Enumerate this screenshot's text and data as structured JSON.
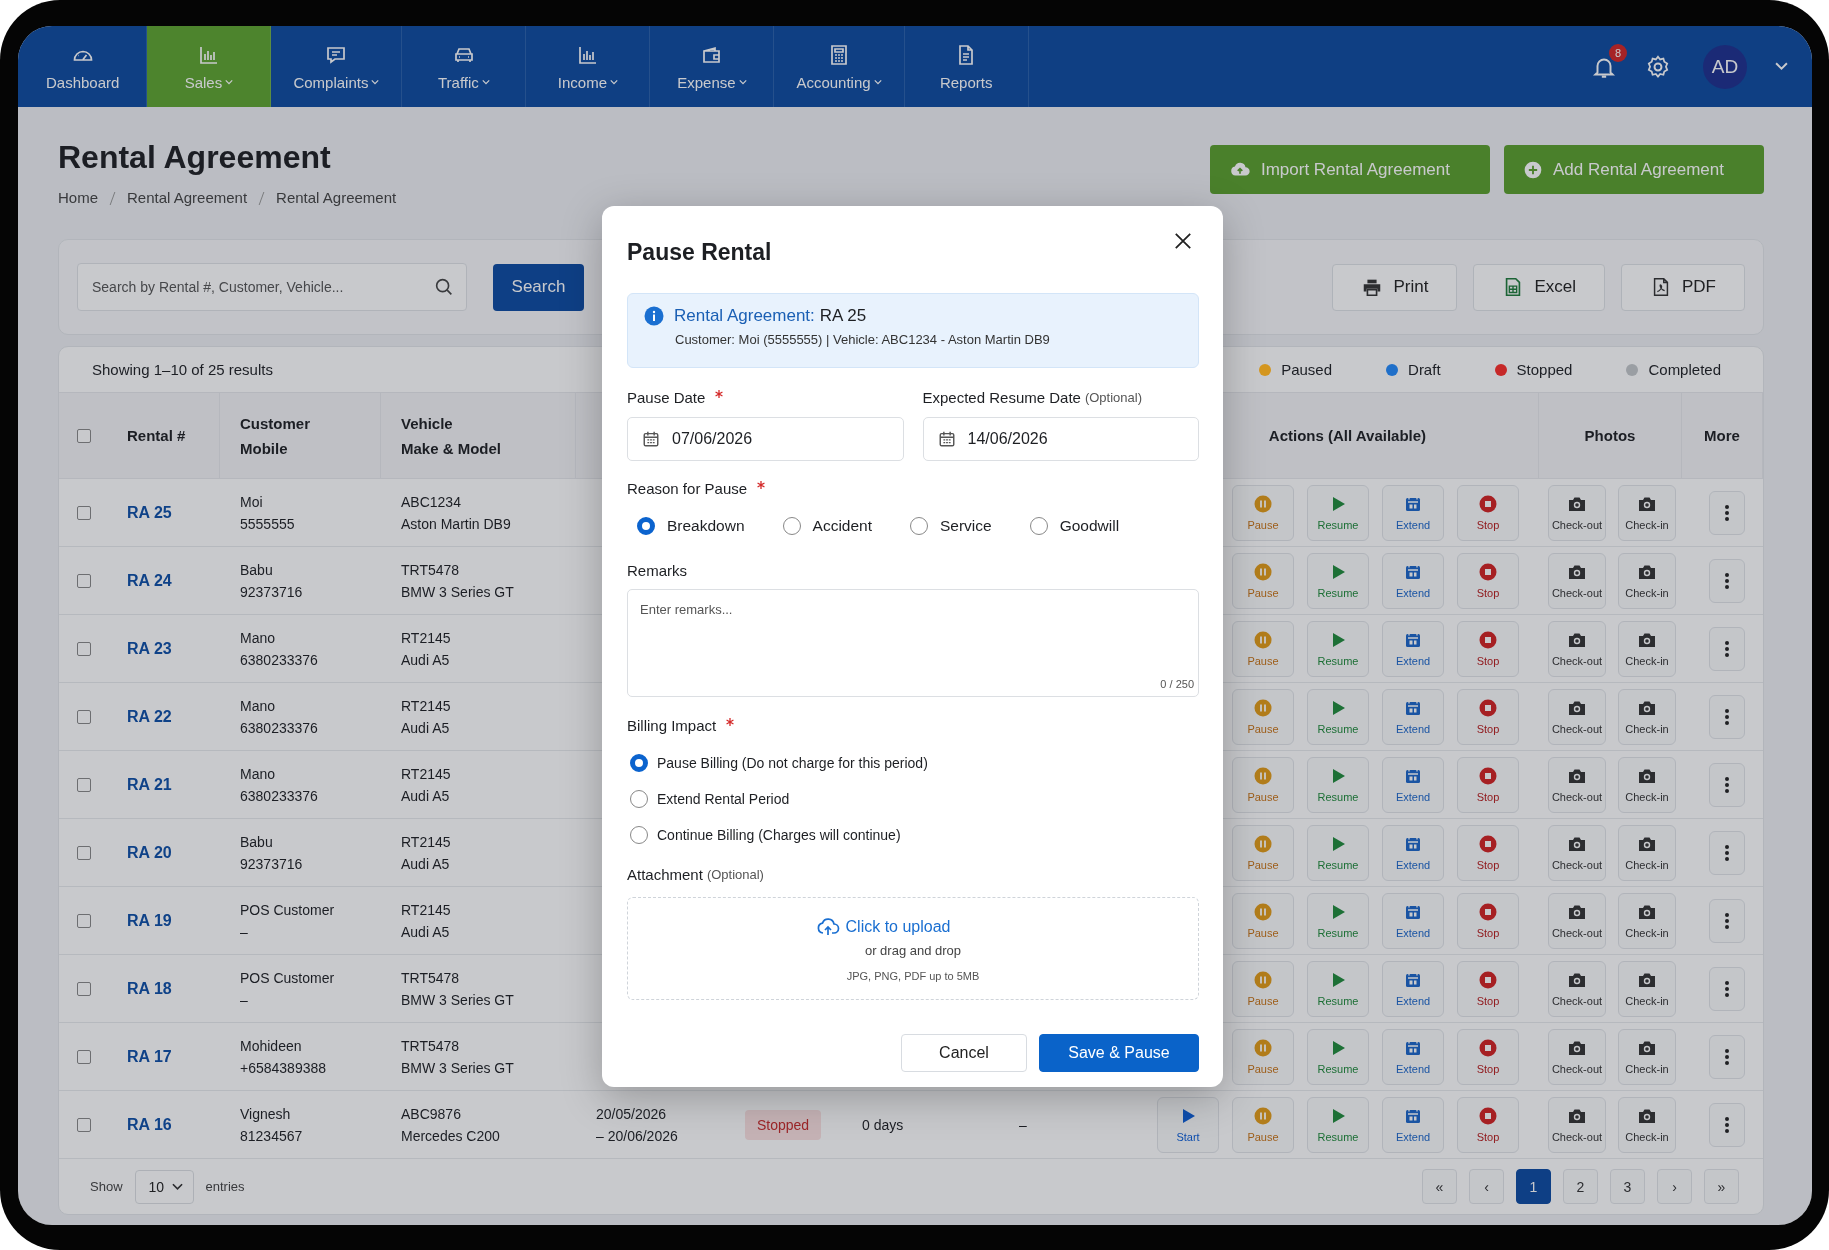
{
  "nav": {
    "items": [
      {
        "label": "Dashboard",
        "selected": false,
        "dropdown": false
      },
      {
        "label": "Sales",
        "selected": true,
        "dropdown": true
      },
      {
        "label": "Complaints",
        "selected": false,
        "dropdown": true
      },
      {
        "label": "Traffic",
        "selected": false,
        "dropdown": true
      },
      {
        "label": "Income",
        "selected": false,
        "dropdown": true
      },
      {
        "label": "Expense",
        "selected": false,
        "dropdown": true
      },
      {
        "label": "Accounting",
        "selected": false,
        "dropdown": true
      },
      {
        "label": "Reports",
        "selected": false,
        "dropdown": false
      }
    ],
    "notifications": "8",
    "user": "AD"
  },
  "page": {
    "title": "Rental Agreement",
    "breadcrumb": [
      "Home",
      "Rental Agreement",
      "Rental Agreement"
    ],
    "actions": [
      "Import Rental Agreement",
      "Add Rental Agreement"
    ]
  },
  "search": {
    "placeholder": "Search by Rental #, Customer, Vehicle...",
    "button": "Search"
  },
  "exports": [
    "Print",
    "Excel",
    "PDF"
  ],
  "summary": "Showing 1–10 of 25 results",
  "legend": [
    {
      "label": "Paused",
      "color": "#d4961f"
    },
    {
      "label": "Draft",
      "color": "#1f6fc9"
    },
    {
      "label": "Stopped",
      "color": "#c62828"
    },
    {
      "label": "Completed",
      "color": "#9a9ea3"
    }
  ],
  "table": {
    "checked": false,
    "columns": [
      [
        "Rental #"
      ],
      [
        "Customer",
        "Mobile"
      ],
      [
        "Vehicle",
        "Make & Model"
      ],
      [
        "Actions (All Available)"
      ],
      [
        "Photos"
      ],
      [
        "More"
      ]
    ],
    "rows": [
      {
        "id": "RA 25",
        "checked": false,
        "customer": "Moi",
        "mobile": "5555555",
        "plate": "ABC1234",
        "model": "Aston Martin DB9",
        "actions": [
          {
            "kind": "pause",
            "label": "Pause"
          },
          {
            "kind": "resume",
            "label": "Resume"
          },
          {
            "kind": "extend",
            "label": "Extend"
          },
          {
            "kind": "stop",
            "label": "Stop"
          }
        ],
        "photos": [
          "Check-out",
          "Check-in"
        ]
      },
      {
        "id": "RA 24",
        "checked": false,
        "customer": "Babu",
        "mobile": "92373716",
        "plate": "TRT5478",
        "model": "BMW 3 Series GT",
        "actions": [
          {
            "kind": "pause",
            "label": "Pause"
          },
          {
            "kind": "resume",
            "label": "Resume"
          },
          {
            "kind": "extend",
            "label": "Extend"
          },
          {
            "kind": "stop",
            "label": "Stop"
          }
        ],
        "photos": [
          "Check-out",
          "Check-in"
        ]
      },
      {
        "id": "RA 23",
        "checked": false,
        "customer": "Mano",
        "mobile": "6380233376",
        "plate": "RT2145",
        "model": "Audi A5",
        "actions": [
          {
            "kind": "pause",
            "label": "Pause"
          },
          {
            "kind": "resume",
            "label": "Resume"
          },
          {
            "kind": "extend",
            "label": "Extend"
          },
          {
            "kind": "stop",
            "label": "Stop"
          }
        ],
        "photos": [
          "Check-out",
          "Check-in"
        ]
      },
      {
        "id": "RA 22",
        "checked": false,
        "customer": "Mano",
        "mobile": "6380233376",
        "plate": "RT2145",
        "model": "Audi A5",
        "actions": [
          {
            "kind": "pause",
            "label": "Pause"
          },
          {
            "kind": "resume",
            "label": "Resume"
          },
          {
            "kind": "extend",
            "label": "Extend"
          },
          {
            "kind": "stop",
            "label": "Stop"
          }
        ],
        "photos": [
          "Check-out",
          "Check-in"
        ]
      },
      {
        "id": "RA 21",
        "checked": false,
        "customer": "Mano",
        "mobile": "6380233376",
        "plate": "RT2145",
        "model": "Audi A5",
        "actions": [
          {
            "kind": "pause",
            "label": "Pause"
          },
          {
            "kind": "resume",
            "label": "Resume"
          },
          {
            "kind": "extend",
            "label": "Extend"
          },
          {
            "kind": "stop",
            "label": "Stop"
          }
        ],
        "photos": [
          "Check-out",
          "Check-in"
        ]
      },
      {
        "id": "RA 20",
        "checked": false,
        "customer": "Babu",
        "mobile": "92373716",
        "plate": "RT2145",
        "model": "Audi A5",
        "actions": [
          {
            "kind": "pause",
            "label": "Pause"
          },
          {
            "kind": "resume",
            "label": "Resume"
          },
          {
            "kind": "extend",
            "label": "Extend"
          },
          {
            "kind": "stop",
            "label": "Stop"
          }
        ],
        "photos": [
          "Check-out",
          "Check-in"
        ]
      },
      {
        "id": "RA 19",
        "checked": false,
        "customer": "POS Customer",
        "mobile": "–",
        "plate": "RT2145",
        "model": "Audi A5",
        "actions": [
          {
            "kind": "pause",
            "label": "Pause"
          },
          {
            "kind": "resume",
            "label": "Resume"
          },
          {
            "kind": "extend",
            "label": "Extend"
          },
          {
            "kind": "stop",
            "label": "Stop"
          }
        ],
        "photos": [
          "Check-out",
          "Check-in"
        ]
      },
      {
        "id": "RA 18",
        "checked": false,
        "customer": "POS Customer",
        "mobile": "–",
        "plate": "TRT5478",
        "model": "BMW 3 Series GT",
        "actions": [
          {
            "kind": "pause",
            "label": "Pause"
          },
          {
            "kind": "resume",
            "label": "Resume"
          },
          {
            "kind": "extend",
            "label": "Extend"
          },
          {
            "kind": "stop",
            "label": "Stop"
          }
        ],
        "photos": [
          "Check-out",
          "Check-in"
        ]
      },
      {
        "id": "RA 17",
        "checked": false,
        "customer": "Mohideen",
        "mobile": "+6584389388",
        "plate": "TRT5478",
        "model": "BMW 3 Series GT",
        "actions": [
          {
            "kind": "pause",
            "label": "Pause"
          },
          {
            "kind": "resume",
            "label": "Resume"
          },
          {
            "kind": "extend",
            "label": "Extend"
          },
          {
            "kind": "stop",
            "label": "Stop"
          }
        ],
        "photos": [
          "Check-out",
          "Check-in"
        ]
      },
      {
        "id": "RA 16",
        "checked": false,
        "customer": "Vignesh",
        "mobile": "81234567",
        "plate": "ABC9876",
        "model": "Mercedes C200",
        "period": [
          "20/05/2026",
          "– 20/06/2026"
        ],
        "status": {
          "label": "Stopped",
          "kind": "stopped"
        },
        "days": "0 days",
        "column_8": "–",
        "actions": [
          {
            "kind": "start",
            "label": "Start"
          },
          {
            "kind": "pause",
            "label": "Pause"
          },
          {
            "kind": "resume",
            "label": "Resume"
          },
          {
            "kind": "extend",
            "label": "Extend"
          },
          {
            "kind": "stop",
            "label": "Stop"
          }
        ],
        "photos": [
          "Check-out",
          "Check-in"
        ]
      }
    ]
  },
  "footer": {
    "show": "Show",
    "page_size": "10",
    "entries": "entries",
    "pages": [
      {
        "label": "«",
        "selected": false
      },
      {
        "label": "‹",
        "selected": false
      },
      {
        "label": "1",
        "selected": true
      },
      {
        "label": "2",
        "selected": false
      },
      {
        "label": "3",
        "selected": false
      },
      {
        "label": "›",
        "selected": false
      },
      {
        "label": "»",
        "selected": false
      }
    ]
  },
  "modal": {
    "title": "Pause Rental",
    "info": {
      "label": "Rental Agreement:",
      "value": "RA 25",
      "details": "Customer: Moi (5555555)  |  Vehicle: ABC1234 - Aston Martin DB9"
    },
    "fields": [
      {
        "label": "Pause Date",
        "required": true,
        "value": "07/06/2026"
      },
      {
        "label": "Expected Resume Date",
        "note": "(Optional)",
        "value": "14/06/2026"
      }
    ],
    "reason": {
      "label": "Reason for Pause",
      "required": true,
      "options": [
        {
          "label": "Breakdown",
          "selected": true
        },
        {
          "label": "Accident",
          "selected": false
        },
        {
          "label": "Service",
          "selected": false
        },
        {
          "label": "Goodwill",
          "selected": false
        }
      ]
    },
    "remarks": {
      "label": "Remarks",
      "placeholder": "Enter remarks...",
      "counter": "0 / 250"
    },
    "billing": {
      "label": "Billing Impact",
      "required": true,
      "options": [
        {
          "label": "Pause Billing (Do not charge for this period)",
          "selected": true
        },
        {
          "label": "Extend Rental Period",
          "selected": false
        },
        {
          "label": "Continue Billing (Charges will continue)",
          "selected": false
        }
      ]
    },
    "attachment": {
      "label": "Attachment",
      "note": "(Optional)",
      "link": "Click to upload",
      "hint": "or drag and drop",
      "formats": "JPG, PNG, PDF up to 5MB"
    },
    "buttons": [
      {
        "label": "Cancel",
        "kind": "secondary"
      },
      {
        "label": "Save & Pause",
        "kind": "primary"
      }
    ]
  }
}
